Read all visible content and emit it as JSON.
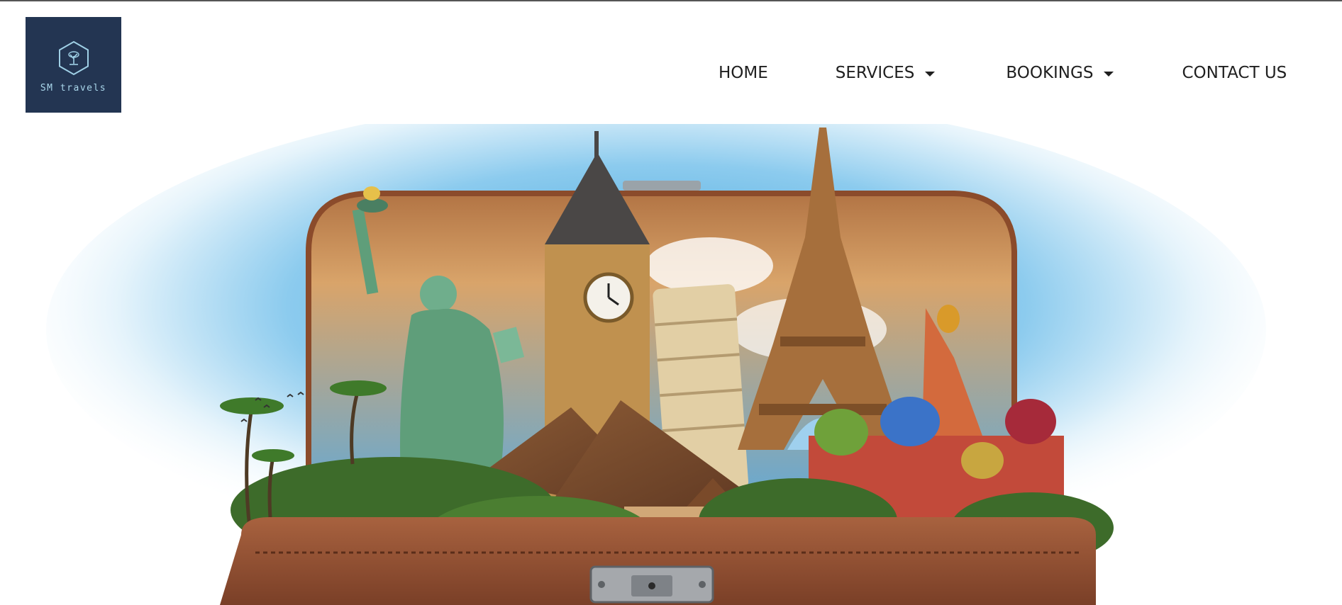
{
  "brand": {
    "logo_text": "SM travels",
    "logo_icon": "hexagon-tree-icon",
    "logo_bg": "#233552"
  },
  "nav": {
    "items": [
      {
        "label": "HOME",
        "dropdown": false
      },
      {
        "label": "SERVICES",
        "dropdown": true
      },
      {
        "label": "BOOKINGS",
        "dropdown": true
      },
      {
        "label": "CONTACT US",
        "dropdown": false
      }
    ]
  },
  "hero": {
    "image": "open suitcase with world landmarks: Statue of Liberty, Big Ben, Leaning Tower of Pisa, Eiffel Tower, Pyramids, St. Basil's Cathedral, palm trees",
    "colors": {
      "suitcase": "#9a5a3a",
      "sky": "#3aa3dc"
    }
  }
}
